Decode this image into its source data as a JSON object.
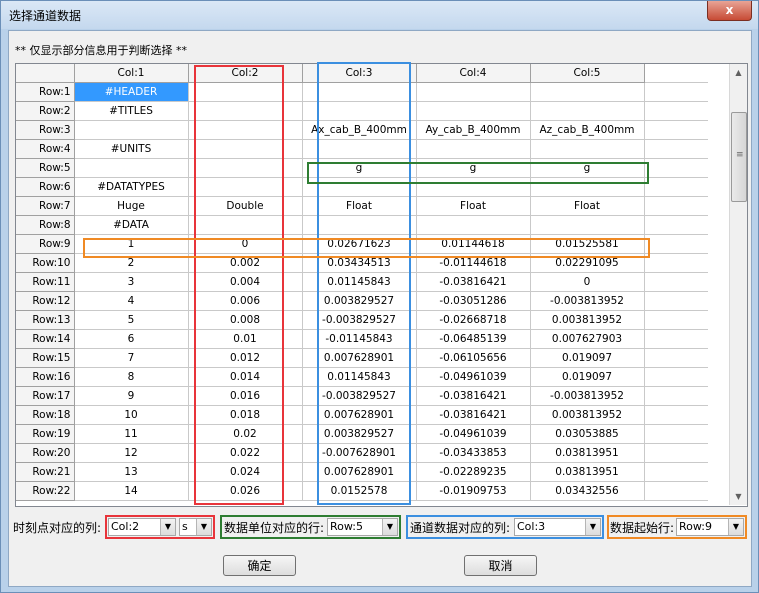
{
  "window": {
    "title": "选择通道数据",
    "close_label": "x"
  },
  "note": "** 仅显示部分信息用于判断选择 **",
  "grid": {
    "columns": [
      "Col:1",
      "Col:2",
      "Col:3",
      "Col:4",
      "Col:5"
    ],
    "rows": [
      {
        "label": "Row:1",
        "cells": [
          "#HEADER",
          "",
          "",
          "",
          ""
        ]
      },
      {
        "label": "Row:2",
        "cells": [
          "#TITLES",
          "",
          "",
          "",
          ""
        ]
      },
      {
        "label": "Row:3",
        "cells": [
          "",
          "",
          "Ax_cab_B_400mm",
          "Ay_cab_B_400mm",
          "Az_cab_B_400mm"
        ]
      },
      {
        "label": "Row:4",
        "cells": [
          "#UNITS",
          "",
          "",
          "",
          ""
        ]
      },
      {
        "label": "Row:5",
        "cells": [
          "",
          "",
          "g",
          "g",
          "g"
        ]
      },
      {
        "label": "Row:6",
        "cells": [
          "#DATATYPES",
          "",
          "",
          "",
          ""
        ]
      },
      {
        "label": "Row:7",
        "cells": [
          "Huge",
          "Double",
          "Float",
          "Float",
          "Float"
        ]
      },
      {
        "label": "Row:8",
        "cells": [
          "#DATA",
          "",
          "",
          "",
          ""
        ]
      },
      {
        "label": "Row:9",
        "cells": [
          "1",
          "0",
          "0.02671623",
          "0.01144618",
          "0.01525581"
        ]
      },
      {
        "label": "Row:10",
        "cells": [
          "2",
          "0.002",
          "0.03434513",
          "-0.01144618",
          "0.02291095"
        ]
      },
      {
        "label": "Row:11",
        "cells": [
          "3",
          "0.004",
          "0.01145843",
          "-0.03816421",
          "0"
        ]
      },
      {
        "label": "Row:12",
        "cells": [
          "4",
          "0.006",
          "0.003829527",
          "-0.03051286",
          "-0.003813952"
        ]
      },
      {
        "label": "Row:13",
        "cells": [
          "5",
          "0.008",
          "-0.003829527",
          "-0.02668718",
          "0.003813952"
        ]
      },
      {
        "label": "Row:14",
        "cells": [
          "6",
          "0.01",
          "-0.01145843",
          "-0.06485139",
          "0.007627903"
        ]
      },
      {
        "label": "Row:15",
        "cells": [
          "7",
          "0.012",
          "0.007628901",
          "-0.06105656",
          "0.019097"
        ]
      },
      {
        "label": "Row:16",
        "cells": [
          "8",
          "0.014",
          "0.01145843",
          "-0.04961039",
          "0.019097"
        ]
      },
      {
        "label": "Row:17",
        "cells": [
          "9",
          "0.016",
          "-0.003829527",
          "-0.03816421",
          "-0.003813952"
        ]
      },
      {
        "label": "Row:18",
        "cells": [
          "10",
          "0.018",
          "0.007628901",
          "-0.03816421",
          "0.003813952"
        ]
      },
      {
        "label": "Row:19",
        "cells": [
          "11",
          "0.02",
          "0.003829527",
          "-0.04961039",
          "0.03053885"
        ]
      },
      {
        "label": "Row:20",
        "cells": [
          "12",
          "0.022",
          "-0.007628901",
          "-0.03433853",
          "0.03813951"
        ]
      },
      {
        "label": "Row:21",
        "cells": [
          "13",
          "0.024",
          "0.007628901",
          "-0.02289235",
          "0.03813951"
        ]
      },
      {
        "label": "Row:22",
        "cells": [
          "14",
          "0.026",
          "0.0152578",
          "-0.01909753",
          "0.03432556"
        ]
      }
    ]
  },
  "controls": {
    "time_col_label": "时刻点对应的列:",
    "time_col_value": "Col:2",
    "time_unit_value": "s",
    "unit_row_label": "数据单位对应的行:",
    "unit_row_value": "Row:5",
    "channel_col_label": "通道数据对应的列:",
    "channel_col_value": "Col:3",
    "start_row_label": "数据起始行:",
    "start_row_value": "Row:9"
  },
  "buttons": {
    "ok": "确定",
    "cancel": "取消"
  },
  "colors": {
    "red": "#e8343a",
    "green": "#2e7d32",
    "blue": "#3b8fe0",
    "orange": "#f08a24"
  }
}
